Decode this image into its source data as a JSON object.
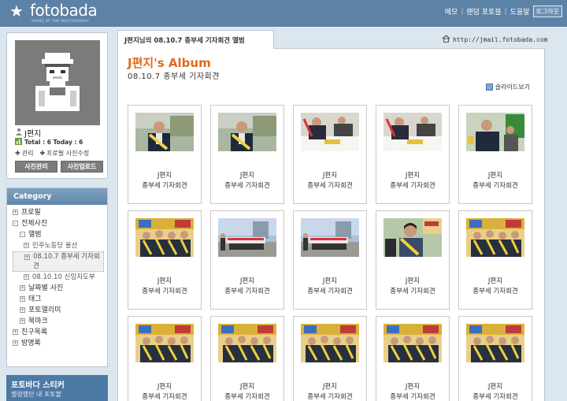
{
  "header": {
    "logo_text": "fotobada",
    "logo_tagline": "SHARE OF THE PHOTOGRAPHY",
    "nav": [
      "메모",
      "랜덤 포토블",
      "도움말"
    ],
    "logout_label": "로그아웃"
  },
  "profile": {
    "username": "J편지",
    "stats": "Total : 6 Today : 6",
    "link_manage": "관리",
    "link_edit": "프로필 사진수정",
    "btn_manage": "사진관리",
    "btn_upload": "사진업로드"
  },
  "category": {
    "heading": "Category",
    "items": [
      {
        "label": "프로필",
        "level": 0,
        "box": "+"
      },
      {
        "label": "전체사진",
        "level": 0,
        "box": "-"
      },
      {
        "label": "앨범",
        "level": 1,
        "box": "-"
      },
      {
        "label": "민주노동당 울산",
        "level": 2,
        "box": "+"
      },
      {
        "label": "08.10.7 종부세 기자회견",
        "level": 2,
        "box": "+",
        "selected": true
      },
      {
        "label": "08.10.10 신임지도부",
        "level": 2,
        "box": "+"
      },
      {
        "label": "날짜별 사진",
        "level": 1,
        "box": "+"
      },
      {
        "label": "태그",
        "level": 1,
        "box": "+"
      },
      {
        "label": "포토앨리미",
        "level": 1,
        "box": "+"
      },
      {
        "label": "북마크",
        "level": 1,
        "box": "+"
      },
      {
        "label": "친구목록",
        "level": 0,
        "box": "+"
      },
      {
        "label": "방명록",
        "level": 0,
        "box": "+"
      }
    ]
  },
  "sticker": {
    "title": "포토바다 스티커",
    "subtitle": "썰렁했던 내 포토블"
  },
  "tab_label": "J편지님의 08.10.7 종부세 기자회견 앨범",
  "blog_url": "http://jmail.fotobada.com",
  "album": {
    "title": "J편지's Album",
    "subtitle": "08.10.7 종부세 기자회견",
    "slideshow_label": "슬라이드보기"
  },
  "photos": [
    {
      "author": "J편지",
      "caption": "종부세 기자회견",
      "scene": "portrait"
    },
    {
      "author": "J편지",
      "caption": "종부세 기자회견",
      "scene": "portrait"
    },
    {
      "author": "J편지",
      "caption": "종부세 기자회견",
      "scene": "signing"
    },
    {
      "author": "J편지",
      "caption": "종부세 기자회견",
      "scene": "signing"
    },
    {
      "author": "J편지",
      "caption": "종부세 기자회견",
      "scene": "speech"
    },
    {
      "author": "J편지",
      "caption": "종부세 기자회견",
      "scene": "group"
    },
    {
      "author": "J편지",
      "caption": "종부세 기자회견",
      "scene": "outdoor"
    },
    {
      "author": "J편지",
      "caption": "종부세 기자회견",
      "scene": "outdoor"
    },
    {
      "author": "J편지",
      "caption": "종부세 기자회견",
      "scene": "woman"
    },
    {
      "author": "J편지",
      "caption": "종부세 기자회견",
      "scene": "group"
    },
    {
      "author": "J편지",
      "caption": "종부세 기자회견",
      "scene": "group"
    },
    {
      "author": "J편지",
      "caption": "종부세 기자회견",
      "scene": "group"
    },
    {
      "author": "J편지",
      "caption": "종부세 기자회견",
      "scene": "group"
    },
    {
      "author": "J편지",
      "caption": "종부세 기자회견",
      "scene": "group"
    },
    {
      "author": "J편지",
      "caption": "종부세 기자회견",
      "scene": "group"
    }
  ]
}
